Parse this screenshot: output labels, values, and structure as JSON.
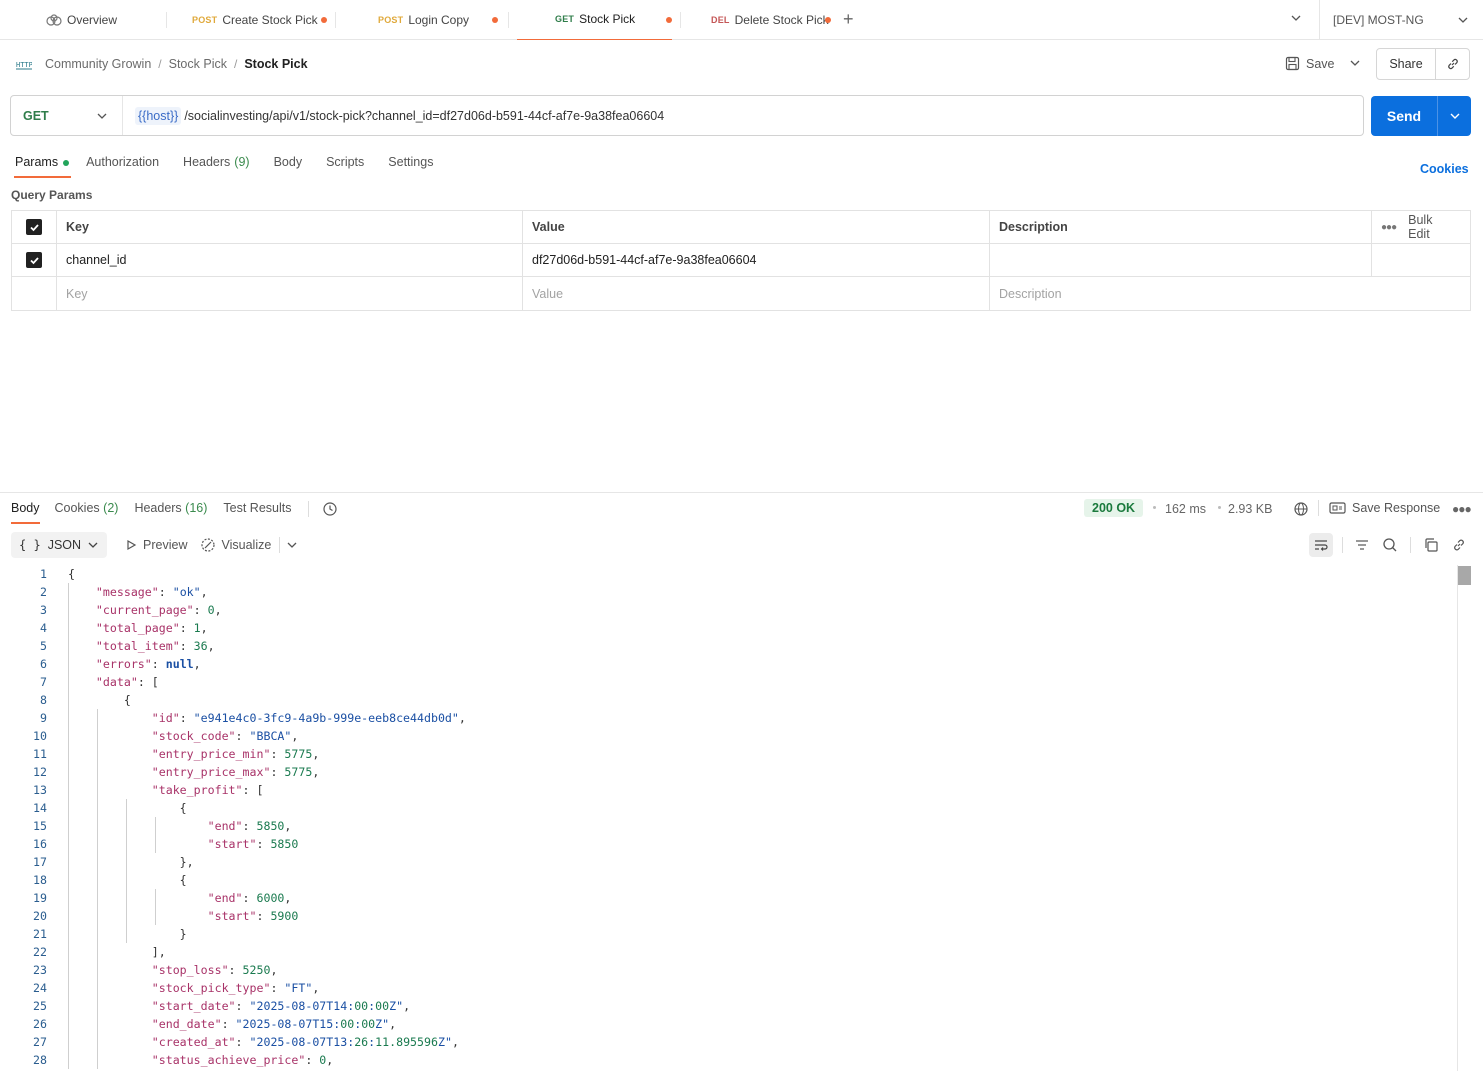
{
  "tabs": [
    {
      "method": "",
      "label": "Overview",
      "dirty": false,
      "active": false
    },
    {
      "method": "POST",
      "label": "Create Stock Pick",
      "dirty": true,
      "active": false
    },
    {
      "method": "POST",
      "label": "Login Copy",
      "dirty": true,
      "active": false
    },
    {
      "method": "GET",
      "label": "Stock Pick",
      "dirty": true,
      "active": true
    },
    {
      "method": "DEL",
      "label": "Delete Stock Pick",
      "dirty": true,
      "active": false
    }
  ],
  "environment": "[DEV] MOST-NG",
  "breadcrumb": {
    "collection": "Community Growin",
    "folder": "Stock Pick",
    "current": "Stock Pick"
  },
  "header": {
    "save_label": "Save",
    "share_label": "Share"
  },
  "request": {
    "method": "GET",
    "host_var": "{{host}}",
    "path": "/socialinvesting/api/v1/stock-pick?channel_id=df27d06d-b591-44cf-af7e-9a38fea06604",
    "send_label": "Send"
  },
  "request_tabs": [
    {
      "label": "Params",
      "count": "",
      "active": true
    },
    {
      "label": "Authorization",
      "count": "",
      "active": false
    },
    {
      "label": "Headers",
      "count": "(9)",
      "active": false
    },
    {
      "label": "Body",
      "count": "",
      "active": false
    },
    {
      "label": "Scripts",
      "count": "",
      "active": false
    },
    {
      "label": "Settings",
      "count": "",
      "active": false
    }
  ],
  "cookies_link": "Cookies",
  "query_params": {
    "title": "Query Params",
    "headers": {
      "key": "Key",
      "value": "Value",
      "description": "Description",
      "bulk_edit": "Bulk Edit"
    },
    "rows": [
      {
        "checked": true,
        "key": "channel_id",
        "value": "df27d06d-b591-44cf-af7e-9a38fea06604",
        "description": ""
      }
    ],
    "placeholders": {
      "key": "Key",
      "value": "Value",
      "description": "Description"
    }
  },
  "response": {
    "tabs": [
      {
        "label": "Body",
        "count": ""
      },
      {
        "label": "Cookies",
        "count": "(2)"
      },
      {
        "label": "Headers",
        "count": "(16)"
      },
      {
        "label": "Test Results",
        "count": ""
      }
    ],
    "status": "200 OK",
    "time": "162 ms",
    "size": "2.93 KB",
    "save_response_label": "Save Response",
    "format": "JSON",
    "preview_label": "Preview",
    "visualize_label": "Visualize"
  },
  "code_lines": [
    "{",
    "    \"message\": \"ok\",",
    "    \"current_page\": 0,",
    "    \"total_page\": 1,",
    "    \"total_item\": 36,",
    "    \"errors\": null,",
    "    \"data\": [",
    "        {",
    "            \"id\": \"e941e4c0-3fc9-4a9b-999e-eeb8ce44db0d\",",
    "            \"stock_code\": \"BBCA\",",
    "            \"entry_price_min\": 5775,",
    "            \"entry_price_max\": 5775,",
    "            \"take_profit\": [",
    "                {",
    "                    \"end\": 5850,",
    "                    \"start\": 5850",
    "                },",
    "                {",
    "                    \"end\": 6000,",
    "                    \"start\": 5900",
    "                }",
    "            ],",
    "            \"stop_loss\": 5250,",
    "            \"stock_pick_type\": \"FT\",",
    "            \"start_date\": \"2025-08-07T14:00:00Z\",",
    "            \"end_date\": \"2025-08-07T15:00:00Z\",",
    "            \"created_at\": \"2025-08-07T13:26:11.895596Z\",",
    "            \"status_achieve_price\": 0,"
  ],
  "colors": {
    "accent": "#f26b3a",
    "send": "#0b6fde",
    "get": "#2f7d4a",
    "post": "#e0a93b",
    "del": "#c45656",
    "ok_bg": "#e6f4ea"
  }
}
